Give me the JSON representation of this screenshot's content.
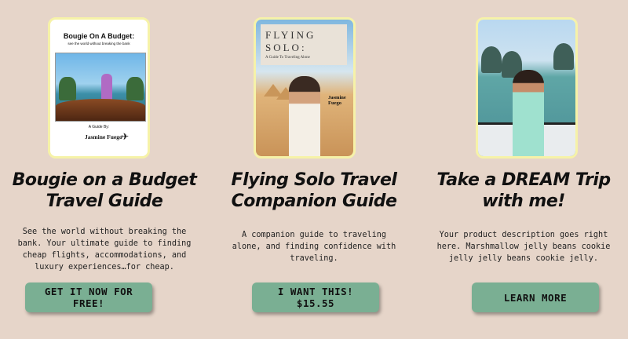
{
  "products": [
    {
      "title_line1": "Bougie on a Budget",
      "title_line2": "Travel Guide",
      "description": "See the world without breaking the bank. Your ultimate guide to finding cheap flights, accommodations, and luxury experiences…for cheap.",
      "button_label": "GET IT NOW FOR FREE!",
      "cover": {
        "heading": "Bougie On A Budget:",
        "subheading": "see the world without breaking the bank",
        "guide_by": "A Guide By:",
        "author": "Jasmine Fuego"
      }
    },
    {
      "title_line1": "Flying Solo Travel",
      "title_line2": "Companion Guide",
      "description": "A companion guide to traveling alone, and finding confidence with traveling.",
      "button_label": "I WANT THIS! $15.55",
      "cover": {
        "title_word1": "FLYING",
        "title_word2": "SOLO:",
        "subtitle": "A Guide To Traveling Alone",
        "author": "Jasmine Fuego"
      }
    },
    {
      "title_line1": "Take a DREAM Trip",
      "title_line2": "with me!",
      "description": "Your product description goes right here. Marshmallow jelly beans cookie jelly jelly beans cookie jelly.",
      "button_label": "LEARN MORE"
    }
  ],
  "colors": {
    "background": "#e6d5c9",
    "button": "#7aaf93",
    "thumb_border": "#f6f2a8"
  }
}
